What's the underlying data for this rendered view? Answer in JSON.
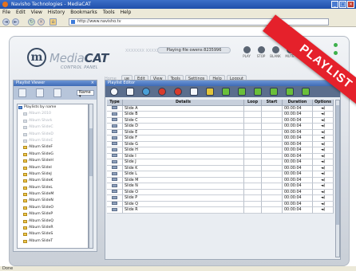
{
  "browser": {
    "title": "Navisho Technologies - MediaCAT",
    "menu": [
      "File",
      "Edit",
      "View",
      "History",
      "Bookmarks",
      "Tools",
      "Help"
    ],
    "url": "http://www.navisho.tv",
    "status": "Done"
  },
  "app": {
    "logo_name_light": "Media",
    "logo_name_bold": "CAT",
    "logo_sub": "CONTROL PANEL",
    "top_info": "XXXXXXX XXXXXXXX",
    "now_playing": "Playing file owens 8235996",
    "transport": [
      "PLAY",
      "STOP",
      "BLANK",
      "MUTE"
    ],
    "nav_tabs": [
      {
        "label": "Home",
        "dim": true
      },
      {
        "label": "ue",
        "dim": false
      },
      {
        "label": "Edit",
        "dim": false
      },
      {
        "label": "View",
        "dim": false
      },
      {
        "label": "Tools",
        "dim": false
      },
      {
        "label": "Settings",
        "dim": false
      },
      {
        "label": "Help",
        "dim": false
      },
      {
        "label": "Logout",
        "dim": false
      }
    ],
    "banner": "PLAYLIST"
  },
  "playlist_viewer": {
    "title": "Playlist Viewer",
    "sort_select": "Name",
    "root": "Playlists by name",
    "items": [
      {
        "label": "Album 2010",
        "dim": true
      },
      {
        "label": "Album Shark",
        "dim": true
      },
      {
        "label": "Album SlideC",
        "dim": true
      },
      {
        "label": "Album SlideD",
        "dim": true
      },
      {
        "label": "Album SlideE",
        "dim": true
      },
      {
        "label": "Album SlideF",
        "dim": false
      },
      {
        "label": "Album SlideG",
        "dim": false
      },
      {
        "label": "Album SlideH",
        "dim": false
      },
      {
        "label": "Album SlideI",
        "dim": false
      },
      {
        "label": "Album SlideJ",
        "dim": false
      },
      {
        "label": "Album SlideK",
        "dim": false
      },
      {
        "label": "Album SlideL",
        "dim": false
      },
      {
        "label": "Album SlideM",
        "dim": false
      },
      {
        "label": "Album SlideN",
        "dim": false
      },
      {
        "label": "Album SlideO",
        "dim": false
      },
      {
        "label": "Album SlideP",
        "dim": false
      },
      {
        "label": "Album SlideQ",
        "dim": false
      },
      {
        "label": "Album SlideR",
        "dim": false
      },
      {
        "label": "Album SlideS",
        "dim": false
      },
      {
        "label": "Album SlideT",
        "dim": false
      }
    ]
  },
  "playlist_editor": {
    "title": "Playlist Editor",
    "columns": [
      "Type",
      "Details",
      "Loop",
      "Start",
      "Duration",
      "Options"
    ],
    "rows": [
      {
        "details": "Slide A",
        "duration": "00:00:04"
      },
      {
        "details": "Slide B",
        "duration": "00:00:04"
      },
      {
        "details": "Slide C",
        "duration": "00:00:04"
      },
      {
        "details": "Slide D",
        "duration": "00:00:04"
      },
      {
        "details": "Slide E",
        "duration": "00:00:04"
      },
      {
        "details": "Slide F",
        "duration": "00:00:04"
      },
      {
        "details": "Slide G",
        "duration": "00:00:04"
      },
      {
        "details": "Slide H",
        "duration": "00:00:04"
      },
      {
        "details": "Slide I",
        "duration": "00:00:04"
      },
      {
        "details": "Slide J",
        "duration": "00:00:04"
      },
      {
        "details": "Slide K",
        "duration": "00:00:04"
      },
      {
        "details": "Slide L",
        "duration": "00:00:04"
      },
      {
        "details": "Slide M",
        "duration": "00:00:04"
      },
      {
        "details": "Slide N",
        "duration": "00:00:04"
      },
      {
        "details": "Slide O",
        "duration": "00:00:04"
      },
      {
        "details": "Slide P",
        "duration": "00:00:04"
      },
      {
        "details": "Slide Q",
        "duration": "00:00:04"
      },
      {
        "details": "Slide R",
        "duration": "00:00:04"
      }
    ],
    "option_glyph": "◄)",
    "toolbar_colors": [
      "#f3f6fb",
      "#f3f6fb",
      "#4aa0d8",
      "#d93b2b",
      "#d93b2b",
      "#f3f6fb",
      "#e3c53a",
      "#6abf3a",
      "#6abf3a",
      "#6abf3a",
      "#6abf3a",
      "#6abf3a",
      "#6abf3a"
    ]
  }
}
